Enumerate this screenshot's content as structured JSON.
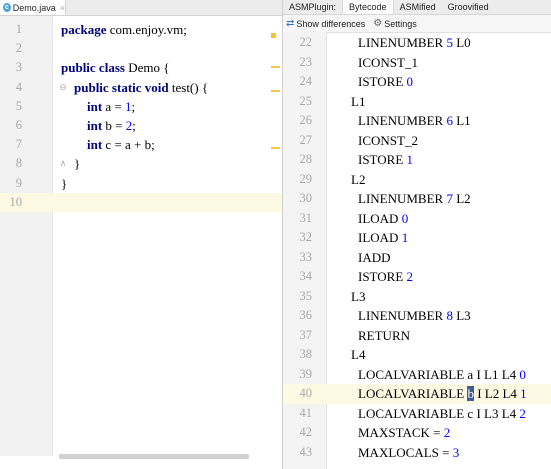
{
  "editor": {
    "file_tab": {
      "icon": "c",
      "name": "Demo.java",
      "close": "×"
    },
    "lines": [
      {
        "n": "1",
        "tokens": [
          {
            "t": "package",
            "c": "kw"
          },
          {
            "t": " com.enjoy.vm;",
            "c": ""
          }
        ]
      },
      {
        "n": "2",
        "tokens": []
      },
      {
        "n": "3",
        "tokens": [
          {
            "t": "public class",
            "c": "kw"
          },
          {
            "t": " Demo {",
            "c": ""
          }
        ]
      },
      {
        "n": "4",
        "tokens": [
          {
            "t": "    public static void",
            "c": "kw"
          },
          {
            "t": " test() {",
            "c": ""
          }
        ]
      },
      {
        "n": "5",
        "tokens": [
          {
            "t": "        int",
            "c": "kw"
          },
          {
            "t": " a = ",
            "c": ""
          },
          {
            "t": "1",
            "c": "num"
          },
          {
            "t": ";",
            "c": ""
          }
        ]
      },
      {
        "n": "6",
        "tokens": [
          {
            "t": "        int",
            "c": "kw"
          },
          {
            "t": " b = ",
            "c": ""
          },
          {
            "t": "2",
            "c": "num"
          },
          {
            "t": ";",
            "c": ""
          }
        ]
      },
      {
        "n": "7",
        "tokens": [
          {
            "t": "        int",
            "c": "kw"
          },
          {
            "t": " c = a + b;",
            "c": ""
          }
        ]
      },
      {
        "n": "8",
        "tokens": [
          {
            "t": "    }",
            "c": ""
          }
        ]
      },
      {
        "n": "9",
        "tokens": [
          {
            "t": "}",
            "c": ""
          }
        ]
      },
      {
        "n": "10",
        "tokens": [],
        "current": true
      }
    ]
  },
  "asm": {
    "tabs": [
      {
        "label": "ASMPlugin:",
        "active": false
      },
      {
        "label": "Bytecode",
        "active": true
      },
      {
        "label": "ASMified",
        "active": false
      },
      {
        "label": "Groovified",
        "active": false
      }
    ],
    "toolbar": {
      "diff_label": "Show differences",
      "settings_label": "Settings"
    },
    "lines": [
      {
        "n": "22",
        "tokens": [
          {
            "t": "LINENUMBER ",
            "c": ""
          },
          {
            "t": "5",
            "c": "num"
          },
          {
            "t": " L0",
            "c": ""
          }
        ]
      },
      {
        "n": "23",
        "tokens": [
          {
            "t": "ICONST_1",
            "c": ""
          }
        ]
      },
      {
        "n": "24",
        "tokens": [
          {
            "t": "ISTORE ",
            "c": ""
          },
          {
            "t": "0",
            "c": "num"
          }
        ]
      },
      {
        "n": "25",
        "label": true,
        "tokens": [
          {
            "t": "L1",
            "c": ""
          }
        ]
      },
      {
        "n": "26",
        "tokens": [
          {
            "t": "LINENUMBER ",
            "c": ""
          },
          {
            "t": "6",
            "c": "num"
          },
          {
            "t": " L1",
            "c": ""
          }
        ]
      },
      {
        "n": "27",
        "tokens": [
          {
            "t": "ICONST_2",
            "c": ""
          }
        ]
      },
      {
        "n": "28",
        "tokens": [
          {
            "t": "ISTORE ",
            "c": ""
          },
          {
            "t": "1",
            "c": "num"
          }
        ]
      },
      {
        "n": "29",
        "label": true,
        "tokens": [
          {
            "t": "L2",
            "c": ""
          }
        ]
      },
      {
        "n": "30",
        "tokens": [
          {
            "t": "LINENUMBER ",
            "c": ""
          },
          {
            "t": "7",
            "c": "num"
          },
          {
            "t": " L2",
            "c": ""
          }
        ]
      },
      {
        "n": "31",
        "tokens": [
          {
            "t": "ILOAD ",
            "c": ""
          },
          {
            "t": "0",
            "c": "num"
          }
        ]
      },
      {
        "n": "32",
        "tokens": [
          {
            "t": "ILOAD ",
            "c": ""
          },
          {
            "t": "1",
            "c": "num"
          }
        ]
      },
      {
        "n": "33",
        "tokens": [
          {
            "t": "IADD",
            "c": ""
          }
        ]
      },
      {
        "n": "34",
        "tokens": [
          {
            "t": "ISTORE ",
            "c": ""
          },
          {
            "t": "2",
            "c": "num"
          }
        ]
      },
      {
        "n": "35",
        "label": true,
        "tokens": [
          {
            "t": "L3",
            "c": ""
          }
        ]
      },
      {
        "n": "36",
        "tokens": [
          {
            "t": "LINENUMBER ",
            "c": ""
          },
          {
            "t": "8",
            "c": "num"
          },
          {
            "t": " L3",
            "c": ""
          }
        ]
      },
      {
        "n": "37",
        "tokens": [
          {
            "t": "RETURN",
            "c": ""
          }
        ]
      },
      {
        "n": "38",
        "label": true,
        "tokens": [
          {
            "t": "L4",
            "c": ""
          }
        ]
      },
      {
        "n": "39",
        "tokens": [
          {
            "t": "LOCALVARIABLE a I L1 L4 ",
            "c": ""
          },
          {
            "t": "0",
            "c": "num"
          }
        ]
      },
      {
        "n": "40",
        "current": true,
        "tokens": [
          {
            "t": "LOCALVARIABLE ",
            "c": ""
          },
          {
            "t": "b",
            "c": "cursel"
          },
          {
            "t": " I L2 L4 ",
            "c": ""
          },
          {
            "t": "1",
            "c": "num"
          }
        ]
      },
      {
        "n": "41",
        "tokens": [
          {
            "t": "LOCALVARIABLE c I L3 L4 ",
            "c": ""
          },
          {
            "t": "2",
            "c": "num"
          }
        ]
      },
      {
        "n": "42",
        "tokens": [
          {
            "t": "MAXSTACK = ",
            "c": ""
          },
          {
            "t": "2",
            "c": "num"
          }
        ]
      },
      {
        "n": "43",
        "tokens": [
          {
            "t": "MAXLOCALS = ",
            "c": ""
          },
          {
            "t": "3",
            "c": "num"
          }
        ]
      }
    ]
  },
  "colors": {
    "keyword": "#000080",
    "number": "#0000ff",
    "current_line": "#fdf9e3",
    "selection": "#3c5d95"
  }
}
